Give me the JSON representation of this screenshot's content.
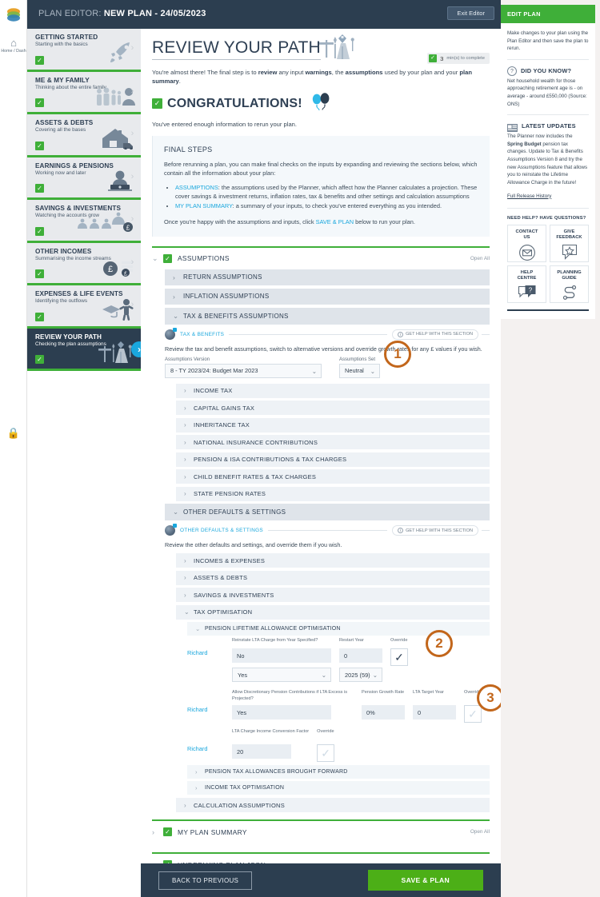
{
  "rail": {
    "home_label": "Home / Dash",
    "home_icon": "home-icon",
    "lock_icon": "lock-icon",
    "logo": "brand-logo"
  },
  "topbar": {
    "prefix": "PLAN EDITOR: ",
    "plan_name": "NEW PLAN - 24/05/2023",
    "exit_label": "Exit Editor"
  },
  "sidebar": {
    "items": [
      {
        "title": "GETTING STARTED",
        "subtitle": "Starting with the basics",
        "icon": "rocket-icon",
        "active": false
      },
      {
        "title": "ME & MY FAMILY",
        "subtitle": "Thinking about the entire family",
        "icon": "family-icon",
        "active": false
      },
      {
        "title": "ASSETS & DEBTS",
        "subtitle": "Covering all the bases",
        "icon": "house-icon",
        "active": false
      },
      {
        "title": "EARNINGS & PENSIONS",
        "subtitle": "Working now and later",
        "icon": "worker-icon",
        "active": false
      },
      {
        "title": "SAVINGS & INVESTMENTS",
        "subtitle": "Watching the accounts grow",
        "icon": "plants-icon",
        "active": false
      },
      {
        "title": "OTHER INCOMES",
        "subtitle": "Summarising the income streams",
        "icon": "moneybag-icon",
        "active": false
      },
      {
        "title": "EXPENSES & LIFE EVENTS",
        "subtitle": "Identifying the outflows",
        "icon": "graduate-icon",
        "active": false
      },
      {
        "title": "REVIEW YOUR PATH",
        "subtitle": "Checking the plan assumptions",
        "icon": "path-icon",
        "active": true
      }
    ]
  },
  "main": {
    "page_title": "REVIEW YOUR PATH",
    "mins_number": "3",
    "mins_text": "min(s) to complete",
    "lede_parts": [
      "You're almost there! The final step is to ",
      "review",
      " any input ",
      "warnings",
      ", the ",
      "assumptions",
      " used by your plan and your ",
      "plan summary",
      "."
    ],
    "congrats": "CONGRATULATIONS!",
    "sub": "You've entered enough information to rerun your plan.",
    "final_steps": {
      "heading": "FINAL STEPS",
      "intro": "Before rerunning a plan, you can make final checks on the inputs by expanding and reviewing the sections below, which contain all the information about your plan:",
      "bullet1_link": "ASSUMPTIONS",
      "bullet1_text": ": the assumptions used by the Planner, which affect how the Planner calculates a projection. These cover savings & investment returns, inflation rates, tax & benefits and other settings and calculation assumptions",
      "bullet2_link": "MY PLAN SUMMARY",
      "bullet2_text": ": a summary of your inputs, to check you've entered everything as you intended.",
      "outro_pre": "Once you're happy with the assumptions and inputs, click ",
      "outro_link": "SAVE & PLAN",
      "outro_post": " below to run your plan."
    },
    "assumptions": {
      "label": "ASSUMPTIONS",
      "open_all": "Open All",
      "rows": [
        {
          "label": "RETURN ASSUMPTIONS",
          "open": false
        },
        {
          "label": "INFLATION ASSUMPTIONS",
          "open": false
        },
        {
          "label": "TAX & BENEFITS ASSUMPTIONS",
          "open": true
        }
      ],
      "tax_section": {
        "title": "TAX & BENEFITS",
        "help": "GET HELP WITH THIS SECTION",
        "desc": "Review the tax and benefit assumptions, switch to alternative versions and override growth rates for any £ values if you wish.",
        "version_label": "Assumptions Version",
        "version_value": "8 - TY 2023/24: Budget Mar 2023",
        "set_label": "Assumptions Set",
        "set_value": "Neutral"
      },
      "tax_rows": [
        "INCOME TAX",
        "CAPITAL GAINS TAX",
        "INHERITANCE TAX",
        "NATIONAL INSURANCE CONTRIBUTIONS",
        "PENSION & ISA CONTRIBUTIONS & TAX CHARGES",
        "CHILD BENEFIT RATES & TAX CHARGES",
        "STATE PENSION RATES"
      ]
    },
    "other_defaults": {
      "label": "OTHER DEFAULTS & SETTINGS",
      "title": "OTHER DEFAULTS & SETTINGS",
      "help": "GET HELP WITH THIS SECTION",
      "desc": "Review the other defaults and settings, and override them if you wish.",
      "rows": [
        {
          "label": "INCOMES & EXPENSES",
          "open": false
        },
        {
          "label": "ASSETS & DEBTS",
          "open": false
        },
        {
          "label": "SAVINGS & INVESTMENTS",
          "open": false
        },
        {
          "label": "TAX OPTIMISATION",
          "open": true
        }
      ],
      "lta": {
        "label": "PENSION LIFETIME ALLOWANCE OPTIMISATION",
        "person": "Richard",
        "f1_label": "Reinstate LTA Charge from Year Specified?",
        "f1_value": "No",
        "f1_select": "Yes",
        "f2_label": "Restart Year",
        "f2_value": "0",
        "f2_select": "2025 (59)",
        "f3_label": "Override",
        "f3_state": "checked",
        "g_person": "Richard",
        "g1_label": "Allow Discretionary Pension Contributions if LTA Excess is Projected?",
        "g1_value": "Yes",
        "g2_label": "Pension Growth Rate",
        "g2_value": "0%",
        "g3_label": "LTA Target Year",
        "g3_value": "0",
        "g4_label": "Override",
        "g4_state": "disabled",
        "h_person": "Richard",
        "h1_label": "LTA Charge Income Conversion Factor",
        "h1_value": "20",
        "h2_label": "Override",
        "h2_state": "disabled"
      },
      "sub_rows": [
        "PENSION TAX ALLOWANCES BROUGHT FORWARD",
        "INCOME TAX OPTIMISATION"
      ],
      "calc_row": "CALCULATION ASSUMPTIONS"
    },
    "plan_summary": {
      "label": "MY PLAN SUMMARY",
      "open_all": "Open All"
    },
    "plan_json": {
      "label": "UNDERLYING PLAN JSON"
    },
    "footer": {
      "back_label": "BACK TO PREVIOUS",
      "save_label": "SAVE & PLAN"
    },
    "markers": [
      "1",
      "2",
      "3"
    ]
  },
  "right_panel": {
    "head": "EDIT PLAN",
    "intro": "Make changes to your plan using the Plan Editor and then save the plan to rerun.",
    "dyk_title": "DID YOU KNOW?",
    "dyk_text": "Net household wealth for those approaching retirement age is - on average - around £550,000 (Source: ONS)",
    "lu_title": "LATEST UPDATES",
    "lu_p1": "The Planner now includes the ",
    "lu_b1": "Spring Budget",
    "lu_p2": " pension tax changes. Update to Tax & Benefits Assumptions Version 8 and try the new Assumptions feature that allows you to reinstate the Lifetime Allowance Charge in the future!",
    "lu_link": "Full Release History",
    "help_title": "NEED HELP? HAVE QUESTIONS?",
    "help_cards": [
      {
        "line1": "CONTACT",
        "line2": "US",
        "icon": "envelope-icon"
      },
      {
        "line1": "GIVE",
        "line2": "FEEDBACK",
        "icon": "star-speech-icon"
      },
      {
        "line1": "HELP",
        "line2": "CENTRE",
        "icon": "question-speech-icon"
      },
      {
        "line1": "PLANNING",
        "line2": "GUIDE",
        "icon": "route-icon"
      }
    ]
  },
  "colors": {
    "navy": "#2c3e50",
    "green": "#3faf39",
    "save_green": "#4caf17",
    "cyan": "#1aa7dd",
    "marker_orange": "#c2661b"
  }
}
